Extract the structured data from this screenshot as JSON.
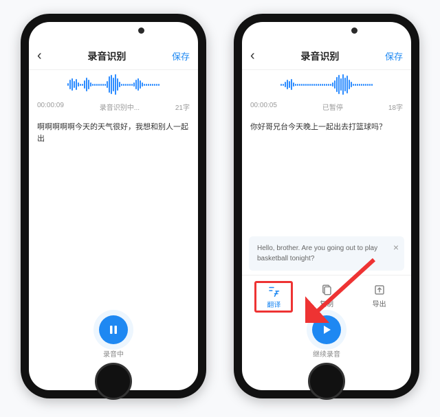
{
  "left": {
    "header": {
      "title": "录音识别",
      "save": "保存"
    },
    "meta": {
      "time": "00:00:09",
      "status": "录音识别中...",
      "count": "21字"
    },
    "transcript": "啊啊啊啊啊今天的天气很好，我想和别人一起出",
    "footer": {
      "rec_label": "录音中",
      "btn_icon": "pause"
    }
  },
  "right": {
    "header": {
      "title": "录音识别",
      "save": "保存"
    },
    "meta": {
      "time": "00:00:05",
      "status": "已暂停",
      "count": "18字"
    },
    "transcript": "你好哥兄台今天晚上一起出去打篮球吗？",
    "translation": "Hello, brother. Are you going out to play basketball tonight?",
    "actions": {
      "translate": "翻译",
      "copy": "复制",
      "export": "导出"
    },
    "footer": {
      "rec_label": "继续录音",
      "btn_icon": "play"
    }
  },
  "colors": {
    "accent": "#1e88f2",
    "highlight": "#e33"
  }
}
